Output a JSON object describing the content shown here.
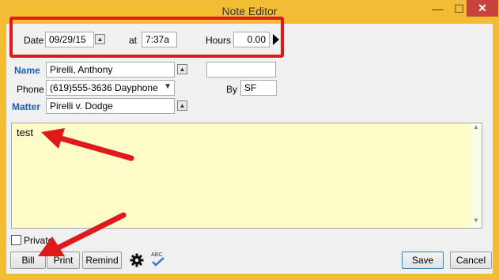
{
  "window": {
    "title": "Note Editor",
    "minimize_glyph": "—",
    "maximize_glyph": "☐",
    "close_glyph": "✕"
  },
  "header": {
    "date_label": "Date",
    "date_value": "09/29/15",
    "at_label": "at",
    "time_value": "7:37a",
    "hours_label": "Hours",
    "hours_value": "0.00",
    "next_icon": "triangle-right-icon"
  },
  "contact": {
    "name_label": "Name",
    "name_value": "Pirelli, Anthony",
    "extra_value": "",
    "phone_label": "Phone",
    "phone_value": "(619)555-3636 Dayphone",
    "by_label": "By",
    "by_value": "SF",
    "matter_label": "Matter",
    "matter_value": "Pirelli v. Dodge"
  },
  "note": {
    "text": "test"
  },
  "options": {
    "private_label": "Private",
    "private_checked": false
  },
  "toolbar": {
    "bill_label": "Bill",
    "print_label": "Print",
    "remind_label": "Remind",
    "settings_icon": "gear-icon",
    "spellcheck_icon": "spellcheck-icon",
    "spellcheck_text": "ABC",
    "save_label": "Save",
    "cancel_label": "Cancel"
  },
  "colors": {
    "title_bar": "#f2bd33",
    "close_button": "#c7433a",
    "highlight": "#e01a1a",
    "label_blue": "#1b5fb3",
    "note_background": "#fefdca"
  }
}
